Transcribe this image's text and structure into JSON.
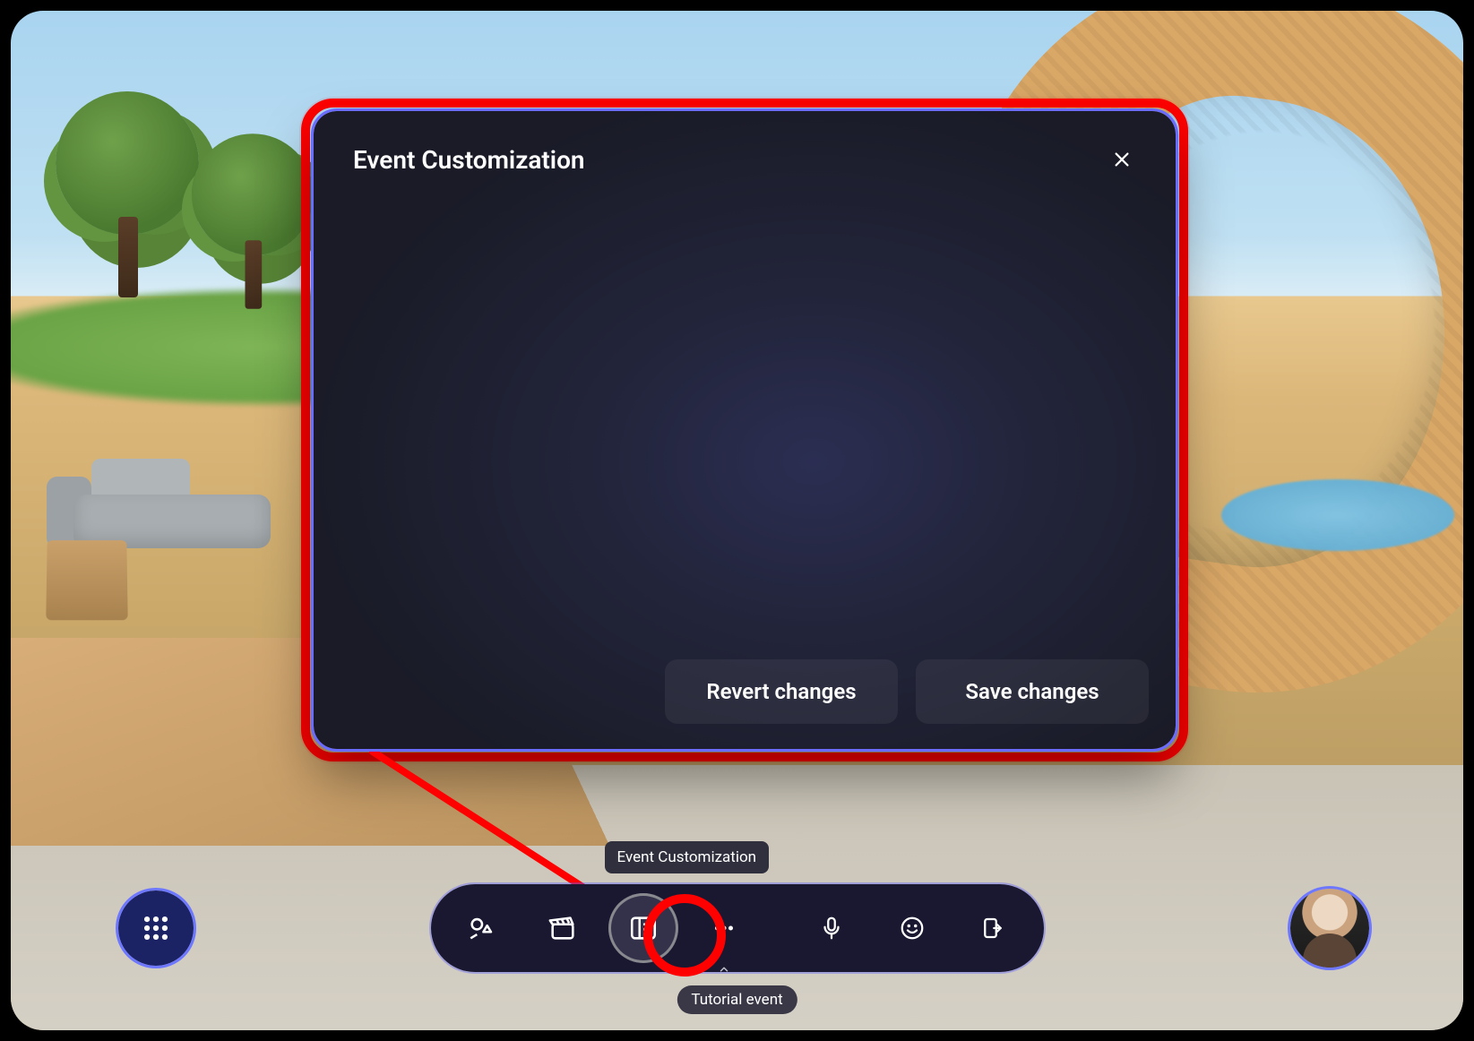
{
  "dialog": {
    "title": "Event Customization",
    "revert_label": "Revert changes",
    "save_label": "Save changes"
  },
  "tooltip": {
    "event_customization": "Event Customization"
  },
  "bottom_bar": {
    "items": [
      {
        "name": "environment-editor",
        "icon": "shapes"
      },
      {
        "name": "media",
        "icon": "clapper"
      },
      {
        "name": "event-customization",
        "icon": "panel-list",
        "active": true
      },
      {
        "name": "more",
        "icon": "dots",
        "caret": true
      },
      {
        "name": "microphone",
        "icon": "mic"
      },
      {
        "name": "reactions",
        "icon": "smile"
      },
      {
        "name": "leave",
        "icon": "door-exit"
      }
    ]
  },
  "event_label": "Tutorial event",
  "colors": {
    "highlight": "#ff0000",
    "accent": "#6a6cff",
    "panel_bg": "#1a1b27"
  }
}
